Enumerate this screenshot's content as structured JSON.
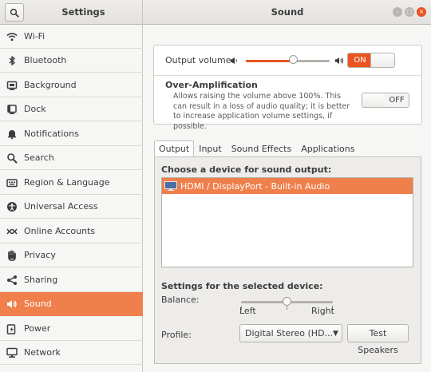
{
  "header": {
    "left_title": "Settings",
    "main_title": "Sound"
  },
  "colors": {
    "accent": "#E95420",
    "selection": "#EF7F4B"
  },
  "sidebar": {
    "items": [
      {
        "label": "Wi-Fi",
        "icon": "wifi-icon"
      },
      {
        "label": "Bluetooth",
        "icon": "bluetooth-icon"
      },
      {
        "label": "Background",
        "icon": "background-icon"
      },
      {
        "label": "Dock",
        "icon": "dock-icon"
      },
      {
        "label": "Notifications",
        "icon": "bell-icon"
      },
      {
        "label": "Search",
        "icon": "search-icon"
      },
      {
        "label": "Region & Language",
        "icon": "region-icon"
      },
      {
        "label": "Universal Access",
        "icon": "accessibility-icon"
      },
      {
        "label": "Online Accounts",
        "icon": "online-accounts-icon"
      },
      {
        "label": "Privacy",
        "icon": "hand-icon"
      },
      {
        "label": "Sharing",
        "icon": "share-icon"
      },
      {
        "label": "Sound",
        "icon": "speaker-icon",
        "selected": true
      },
      {
        "label": "Power",
        "icon": "power-icon"
      },
      {
        "label": "Network",
        "icon": "network-icon"
      }
    ]
  },
  "output_volume": {
    "label": "Output volume:",
    "level": 0.57,
    "toggle_label": "ON"
  },
  "over_amplification": {
    "title": "Over-Amplification",
    "description": "Allows raising the volume above 100%. This can result in a loss of audio quality; it is better to increase application volume settings, if possible.",
    "toggle_label": "OFF"
  },
  "tabs": [
    {
      "label": "Output",
      "active": true
    },
    {
      "label": "Input"
    },
    {
      "label": "Sound Effects"
    },
    {
      "label": "Applications"
    }
  ],
  "output": {
    "device_heading": "Choose a device for sound output:",
    "devices": [
      "HDMI / DisplayPort - Built-in Audio"
    ],
    "settings_heading": "Settings for the selected device:",
    "balance_label": "Balance:",
    "balance_value": 0.5,
    "balance_left": "Left",
    "balance_right": "Right",
    "profile_label": "Profile:",
    "profile_value": "Digital Stereo (HD...",
    "test_button": "Test Speakers"
  }
}
